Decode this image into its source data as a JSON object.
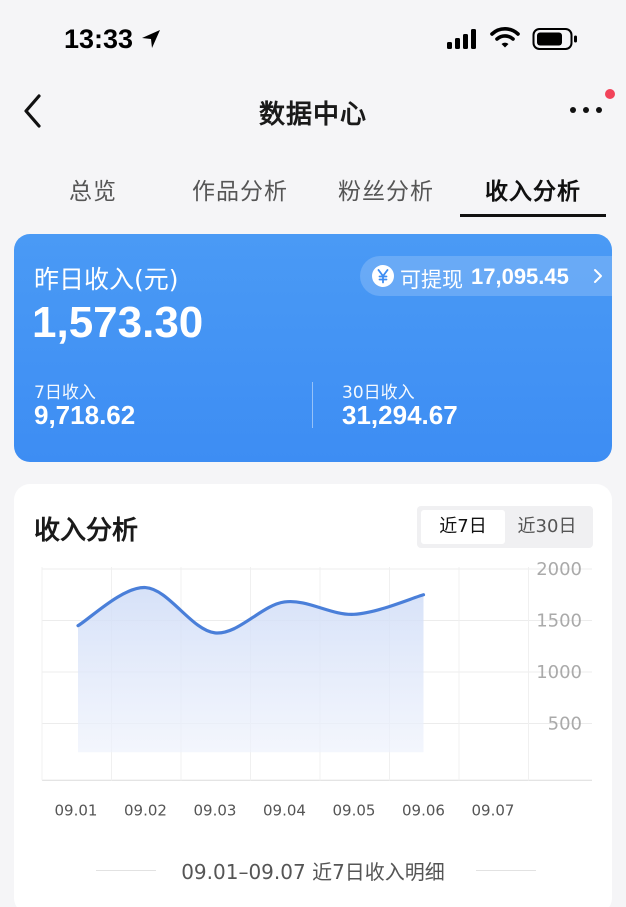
{
  "status_bar": {
    "time": "13:33",
    "icons": [
      "location-arrow-icon",
      "signal-icon",
      "wifi-icon",
      "battery-icon"
    ]
  },
  "nav": {
    "title": "数据中心",
    "icons": [
      "back-icon",
      "more-icon"
    ]
  },
  "tabs": [
    {
      "label": "总览",
      "active": false
    },
    {
      "label": "作品分析",
      "active": false
    },
    {
      "label": "粉丝分析",
      "active": false
    },
    {
      "label": "收入分析",
      "active": true
    }
  ],
  "income_card": {
    "label": "昨日收入(元)",
    "amount": "1,573.30",
    "withdraw_label": "可提现",
    "withdraw_amount": "17,095.45",
    "stats": [
      {
        "label": "7日收入",
        "value": "9,718.62"
      },
      {
        "label": "30日收入",
        "value": "31,294.67"
      }
    ],
    "color": "#3d8df3"
  },
  "analysis": {
    "title": "收入分析",
    "range_options": [
      "近7日",
      "近30日"
    ],
    "selected_range": "近7日",
    "detail_caption": "09.01–09.07 近7日收入明细"
  },
  "chart_data": {
    "type": "area",
    "x": [
      "09.01",
      "09.02",
      "09.03",
      "09.04",
      "09.05",
      "09.06",
      "09.07"
    ],
    "y_ticks": [
      "2000",
      "1500",
      "1000",
      "500"
    ],
    "ylim": [
      0,
      2000
    ],
    "grid": true,
    "series": [
      {
        "values": [
          1450,
          1820,
          1380,
          1680,
          1560,
          1750,
          null
        ],
        "color": "#4a7fd9"
      }
    ]
  }
}
